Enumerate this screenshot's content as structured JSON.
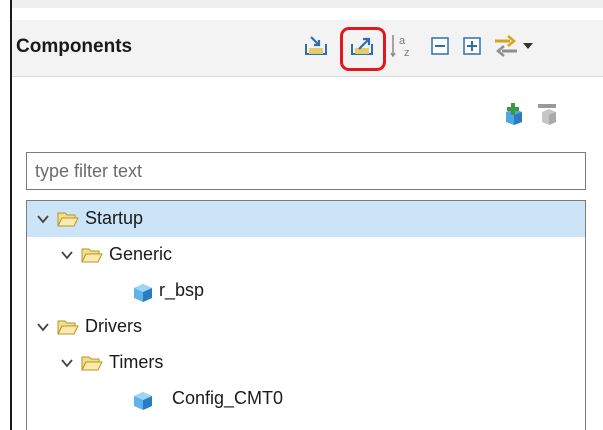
{
  "header": {
    "title": "Components"
  },
  "toolbar": {
    "icons": [
      "import-component-icon",
      "export-component-icon",
      "sort-alphabetical-icon",
      "collapse-all-icon",
      "expand-all-icon",
      "link-with-editor-icon",
      "view-menu-icon"
    ],
    "highlighted": "export-component-icon",
    "highlight_color": "#e0191e"
  },
  "actions": {
    "icons": [
      "add-component-icon",
      "remove-component-icon"
    ]
  },
  "filter": {
    "placeholder": "type filter text",
    "value": ""
  },
  "tree": {
    "selected_color": "#cce4f7",
    "items": [
      {
        "label": "Startup",
        "type": "folder",
        "expanded": true,
        "selected": true
      },
      {
        "label": "Generic",
        "type": "folder",
        "expanded": true,
        "selected": false
      },
      {
        "label": "r_bsp",
        "type": "component",
        "selected": false
      },
      {
        "label": "Drivers",
        "type": "folder",
        "expanded": true,
        "selected": false
      },
      {
        "label": "Timers",
        "type": "folder",
        "expanded": true,
        "selected": false
      },
      {
        "label": "Config_CMT0",
        "type": "component",
        "selected": false
      }
    ]
  }
}
